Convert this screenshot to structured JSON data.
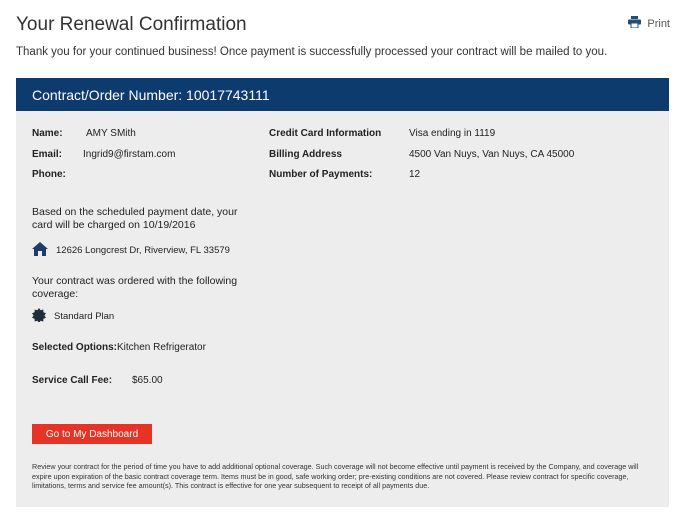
{
  "page": {
    "title": "Your Renewal Confirmation",
    "print_label": "Print",
    "thanks_message": "Thank you for your continued business! Once payment is successfully processed your contract will be mailed to you."
  },
  "card": {
    "header": "Contract/Order Number: 10017743111",
    "customer": {
      "name_label": "Name:",
      "name_value": "AMY SMith",
      "email_label": "Email:",
      "email_value": "Ingrid9@firstam.com",
      "phone_label": "Phone:",
      "phone_value": ""
    },
    "payment": {
      "card_label": "Credit Card Information",
      "card_value": "Visa ending in 1119",
      "billing_label": "Billing Address",
      "billing_value": "4500 Van Nuys, Van Nuys, CA 45000",
      "payments_label": "Number of Payments:",
      "payments_value": "12"
    },
    "charge_line1": "Based on the scheduled payment date, your",
    "charge_line2": "card will be charged on 10/19/2016",
    "property_address": "12626 Longcrest Dr, Riverview, FL 33579",
    "coverage_line1": "Your contract was ordered with the following",
    "coverage_line2": "coverage:",
    "plan_name": "Standard Plan",
    "options_label": "Selected Options:",
    "options_value": "Kitchen Refrigerator",
    "fee_label": "Service Call Fee:",
    "fee_value": "$65.00",
    "dashboard_button": "Go to My Dashboard",
    "disclaimer": "Review your contract for the period of time you have to add additional optional coverage. Such coverage will not become effective until payment is received by the Company, and coverage will expire upon expiration of the basic contract coverage term. Items must be in good, safe working order; pre-existing conditions are not covered. Please review contract for specific coverage, limitations, terms and service fee amount(s). This contract is effective for one year subsequent to receipt of all payments due."
  },
  "colors": {
    "header_bg": "#0d3b6e",
    "card_bg": "#ededed",
    "button_bg": "#e63325"
  },
  "icons": {
    "print": "printer-icon",
    "home": "home-icon",
    "plan": "badge-icon"
  }
}
